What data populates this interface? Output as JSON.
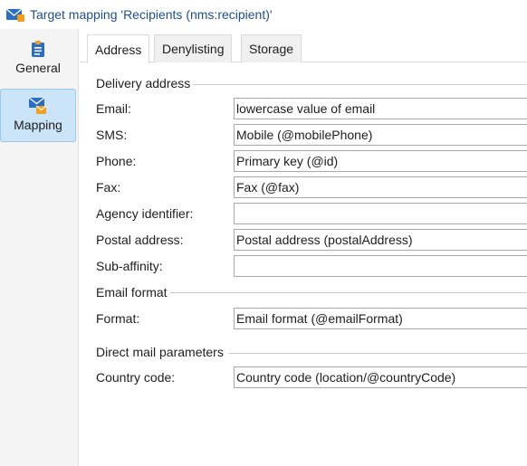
{
  "window": {
    "title": "Target mapping 'Recipients (nms:recipient)'"
  },
  "sidebar": {
    "items": [
      {
        "label": "General",
        "icon": "clipboard-icon"
      },
      {
        "label": "Mapping",
        "icon": "envelope-stack-icon",
        "active": true
      }
    ]
  },
  "tabs": [
    {
      "label": "Address",
      "active": true
    },
    {
      "label": "Denylisting"
    },
    {
      "label": "Storage"
    }
  ],
  "sections": {
    "delivery_address": {
      "title": "Delivery address",
      "fields": {
        "email": {
          "label": "Email:",
          "value": "lowercase value of email"
        },
        "sms": {
          "label": "SMS:",
          "value": "Mobile (@mobilePhone)"
        },
        "phone": {
          "label": "Phone:",
          "value": "Primary key (@id)"
        },
        "fax": {
          "label": "Fax:",
          "value": "Fax (@fax)"
        },
        "agency_identifier": {
          "label": "Agency identifier:",
          "value": ""
        },
        "postal_address": {
          "label": "Postal address:",
          "value": "Postal address (postalAddress)"
        },
        "sub_affinity": {
          "label": "Sub-affinity:",
          "value": ""
        }
      }
    },
    "email_format": {
      "title": "Email format",
      "fields": {
        "format": {
          "label": "Format:",
          "value": "Email format (@emailFormat)"
        }
      }
    },
    "direct_mail": {
      "title": "Direct mail parameters",
      "fields": {
        "country_code": {
          "label": "Country code:",
          "value": "Country code (location/@countryCode)"
        }
      }
    }
  },
  "colors": {
    "accent": "#1f4e8c",
    "selected_bg": "#cce4f7",
    "selected_border": "#99c9ef"
  }
}
